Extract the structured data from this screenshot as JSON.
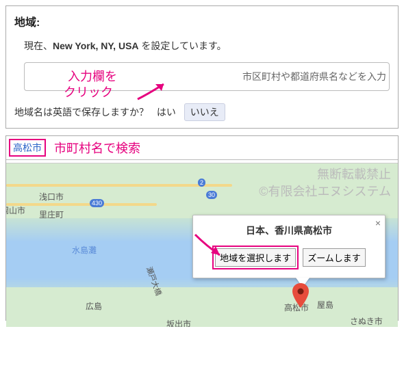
{
  "region": {
    "title": "地域:",
    "current_prefix": "現在、",
    "current_location": "New York, NY, USA",
    "current_suffix": " を設定しています。",
    "input_placeholder": "市区町村や都道府県名などを入力",
    "note_line1": "入力欄を",
    "note_line2": "クリック",
    "save_question": "地域名は英語で保存しますか？",
    "yes": "はい",
    "no": "いいえ"
  },
  "search": {
    "term": "高松市",
    "hint": "市町村名で検索"
  },
  "watermark": {
    "line1": "無断転載禁止",
    "line2": "©有限会社エヌシステム"
  },
  "map": {
    "sea_label": "水島灘",
    "cities": {
      "asakuchi": "浅口市",
      "okayama": "岡山市",
      "satosho": "里庄町",
      "hiroshima": "広島",
      "takamatsu": "高松市",
      "yashima": "屋島",
      "sakaide": "坂出市",
      "sanuki": "さぬき市"
    },
    "bridge_label": "瀬戸大橋",
    "routes": {
      "r2": "2",
      "r30": "30",
      "r430": "430"
    }
  },
  "infowin": {
    "title": "日本、香川県高松市",
    "select_btn": "地域を選択します",
    "zoom_btn": "ズームします",
    "close": "×"
  }
}
